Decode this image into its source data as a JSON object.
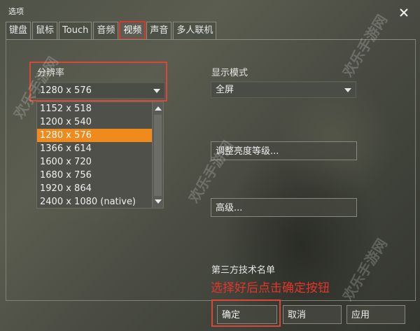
{
  "window": {
    "title": "选项",
    "close_icon": "close-icon"
  },
  "tabs": [
    {
      "label": "键盘",
      "active": false
    },
    {
      "label": "鼠标",
      "active": false
    },
    {
      "label": "Touch",
      "active": false
    },
    {
      "label": "音频",
      "active": false
    },
    {
      "label": "视频",
      "active": true
    },
    {
      "label": "声音",
      "active": false
    },
    {
      "label": "多人联机",
      "active": false
    }
  ],
  "resolution": {
    "label": "分辨率",
    "selected": "1280 x 576",
    "options": [
      "1152 x 518",
      "1200 x 540",
      "1280 x 576",
      "1366 x 614",
      "1600 x 720",
      "1680 x 756",
      "1920 x 864",
      "2400 x 1080 (native)"
    ],
    "highlighted_index": 2
  },
  "display_mode": {
    "label": "显示模式",
    "selected": "全屏"
  },
  "buttons": {
    "brightness": "调整亮度等级...",
    "advanced": "高级...",
    "ok": "确定",
    "cancel": "取消",
    "apply": "应用"
  },
  "third_party": "第三方技术名单",
  "annotation": "选择好后点击确定按钮",
  "watermarks": [
    "欢乐手游网",
    "欢乐手游网",
    "欢乐手游网",
    "欢乐手游网"
  ],
  "colors": {
    "highlight": "#f08a1c",
    "annotation": "#e3352b"
  }
}
